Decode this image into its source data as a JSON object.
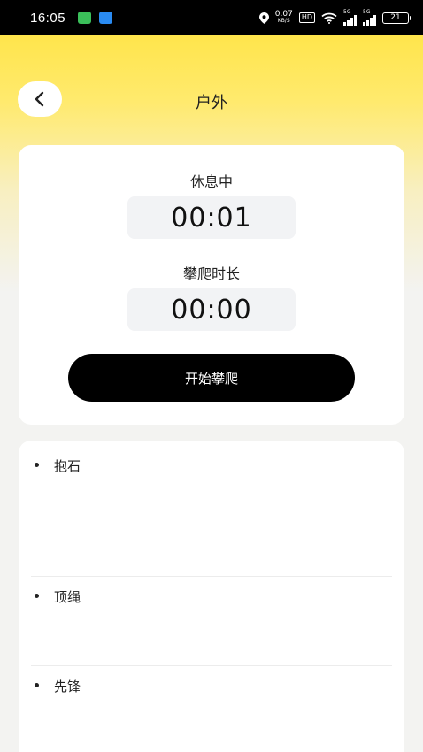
{
  "status_bar": {
    "time": "16:05",
    "speed_value": "0.07",
    "speed_unit": "KB/S",
    "hd": "HD",
    "network_1": "5G",
    "network_2": "5G",
    "battery": "21"
  },
  "header": {
    "title": "户外"
  },
  "timer": {
    "rest_label": "休息中",
    "rest_time": "00:01",
    "climb_label": "攀爬时长",
    "climb_time": "00:00",
    "start_button": "开始攀爬"
  },
  "categories": [
    {
      "label": "抱石"
    },
    {
      "label": "顶绳"
    },
    {
      "label": "先锋"
    }
  ]
}
